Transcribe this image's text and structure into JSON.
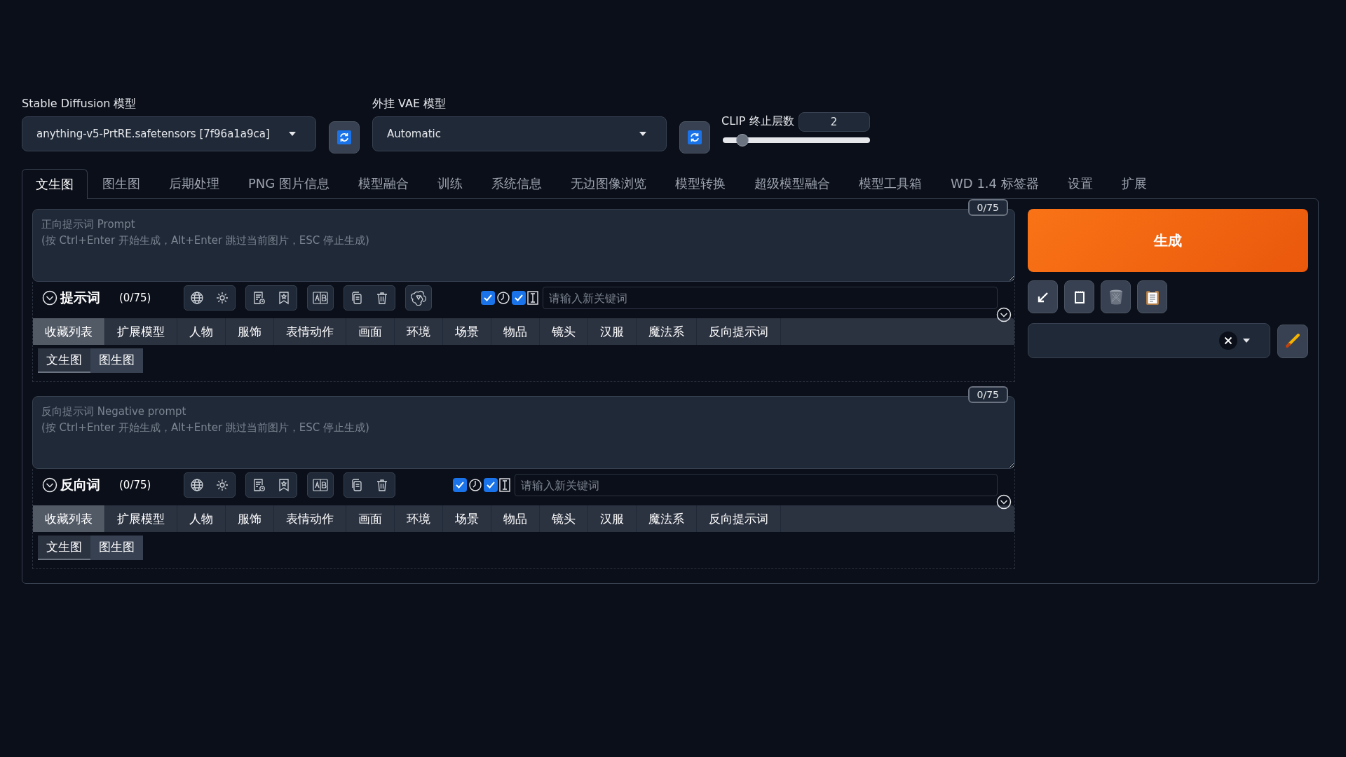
{
  "model_select": {
    "label": "Stable Diffusion 模型",
    "value": "anything-v5-PrtRE.safetensors [7f96a1a9ca]"
  },
  "vae_select": {
    "label": "外挂 VAE 模型",
    "value": "Automatic"
  },
  "clip_skip": {
    "label": "CLIP 终止层数",
    "value": "2",
    "level": 0.09
  },
  "tabs": [
    {
      "label": "文生图",
      "selected": true
    },
    {
      "label": "图生图",
      "selected": false
    },
    {
      "label": "后期处理",
      "selected": false
    },
    {
      "label": "PNG 图片信息",
      "selected": false
    },
    {
      "label": "模型融合",
      "selected": false
    },
    {
      "label": "训练",
      "selected": false
    },
    {
      "label": "系统信息",
      "selected": false
    },
    {
      "label": "无边图像浏览",
      "selected": false
    },
    {
      "label": "模型转换",
      "selected": false
    },
    {
      "label": "超级模型融合",
      "selected": false
    },
    {
      "label": "模型工具箱",
      "selected": false
    },
    {
      "label": "WD 1.4 标签器",
      "selected": false
    },
    {
      "label": "设置",
      "selected": false
    },
    {
      "label": "扩展",
      "selected": false
    }
  ],
  "prompts": [
    {
      "kind": "positive",
      "token_count": "0/75",
      "placeholder": "正向提示词 Prompt\n(按 Ctrl+Enter 开始生成，Alt+Enter 跳过当前图片，ESC 停止生成)",
      "title": "提示词",
      "count": "(0/75)",
      "checks": [
        {
          "checked": true
        },
        {
          "checked": true
        }
      ],
      "keyword_placeholder": "请输入新关键词",
      "categories": [
        {
          "label": "收藏列表",
          "selected": true
        },
        {
          "label": "扩展模型",
          "selected": false
        },
        {
          "label": "人物",
          "selected": false
        },
        {
          "label": "服饰",
          "selected": false
        },
        {
          "label": "表情动作",
          "selected": false
        },
        {
          "label": "画面",
          "selected": false
        },
        {
          "label": "环境",
          "selected": false
        },
        {
          "label": "场景",
          "selected": false
        },
        {
          "label": "物品",
          "selected": false
        },
        {
          "label": "镜头",
          "selected": false
        },
        {
          "label": "汉服",
          "selected": false
        },
        {
          "label": "魔法系",
          "selected": false
        },
        {
          "label": "反向提示词",
          "selected": false
        }
      ],
      "subtabs": [
        {
          "label": "文生图",
          "selected": true
        },
        {
          "label": "图生图",
          "selected": false
        }
      ]
    },
    {
      "kind": "negative",
      "token_count": "0/75",
      "placeholder": "反向提示词 Negative prompt\n(按 Ctrl+Enter 开始生成，Alt+Enter 跳过当前图片，ESC 停止生成)",
      "title": "反向词",
      "count": "(0/75)",
      "checks": [
        {
          "checked": true
        },
        {
          "checked": true
        }
      ],
      "keyword_placeholder": "请输入新关键词",
      "categories": [
        {
          "label": "收藏列表",
          "selected": true
        },
        {
          "label": "扩展模型",
          "selected": false
        },
        {
          "label": "人物",
          "selected": false
        },
        {
          "label": "服饰",
          "selected": false
        },
        {
          "label": "表情动作",
          "selected": false
        },
        {
          "label": "画面",
          "selected": false
        },
        {
          "label": "环境",
          "selected": false
        },
        {
          "label": "场景",
          "selected": false
        },
        {
          "label": "物品",
          "selected": false
        },
        {
          "label": "镜头",
          "selected": false
        },
        {
          "label": "汉服",
          "selected": false
        },
        {
          "label": "魔法系",
          "selected": false
        },
        {
          "label": "反向提示词",
          "selected": false
        }
      ],
      "subtabs": [
        {
          "label": "文生图",
          "selected": true
        },
        {
          "label": "图生图",
          "selected": false
        }
      ]
    }
  ],
  "generate_button": "生成"
}
